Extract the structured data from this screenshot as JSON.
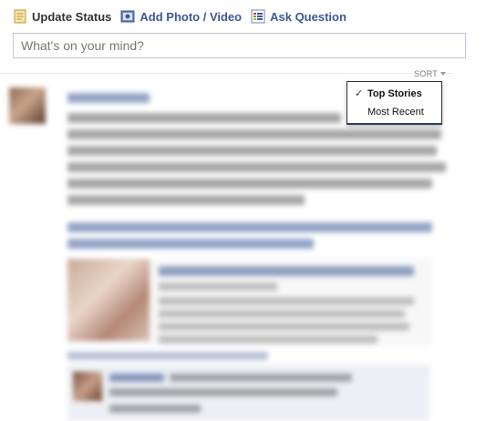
{
  "composer": {
    "tabs": [
      {
        "label": "Update Status",
        "icon": "status-note-icon"
      },
      {
        "label": "Add Photo / Video",
        "icon": "camera-icon"
      },
      {
        "label": "Ask Question",
        "icon": "question-list-icon"
      }
    ],
    "placeholder": "What's on your mind?"
  },
  "feed": {
    "sort_label": "SORT",
    "sort_menu": {
      "items": [
        {
          "label": "Top Stories",
          "selected": true
        },
        {
          "label": "Most Recent",
          "selected": false
        }
      ]
    }
  },
  "colors": {
    "link": "#3b5998",
    "border": "#bdc7d8",
    "menu_border": "#293e6a"
  }
}
